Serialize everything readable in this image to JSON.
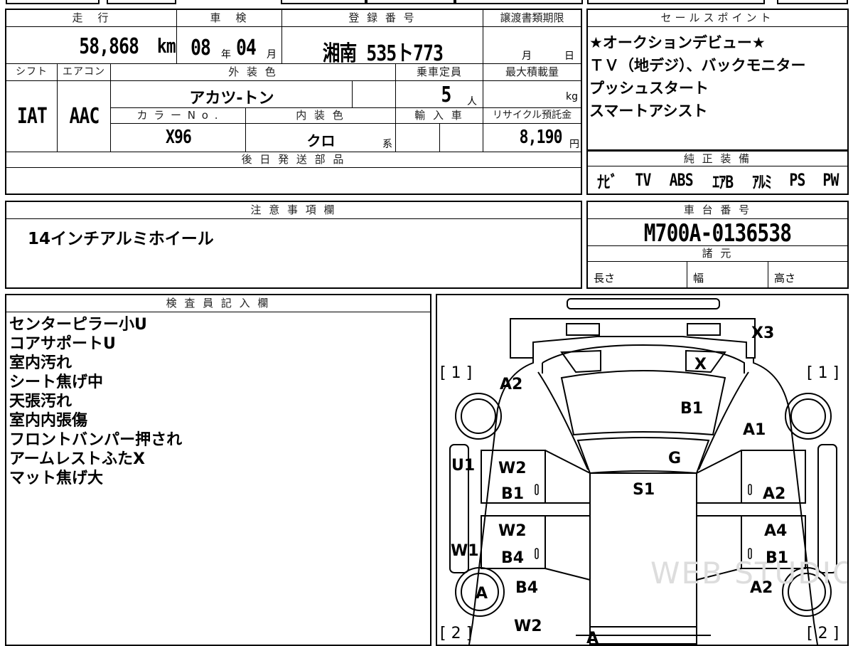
{
  "vehicle": {
    "mileage_label": "走　行",
    "mileage_value": "58,868",
    "mileage_unit": "km",
    "shaken_label": "車　検",
    "shaken_year": "08",
    "shaken_year_unit": "年",
    "shaken_month": "04",
    "shaken_month_unit": "月",
    "reg_label": "登 録 番 号",
    "reg_value": "湘南 535ト773",
    "transfer_label": "譲渡書類期限",
    "transfer_month_unit": "月",
    "transfer_day_unit": "日",
    "shift_label": "シフト",
    "shift_value": "IAT",
    "ac_label": "エアコン",
    "ac_value": "AAC",
    "exterior_label": "外 装 色",
    "exterior_value": "アカツ-トン",
    "capacity_label": "乗車定員",
    "capacity_value": "5",
    "capacity_unit": "人",
    "maxload_label": "最大積載量",
    "maxload_unit": "kg",
    "color_no_label": "カ ラ ー N o .",
    "color_no_value": "X96",
    "interior_label": "内 装 色",
    "interior_value": "クロ",
    "interior_unit": "系",
    "import_label": "輸 入 車",
    "recycle_label": "リサイクル預託金",
    "recycle_value": "8,190",
    "recycle_unit": "円",
    "later_parts_label": "後 日 発 送 部 品"
  },
  "sales": {
    "label": "セールスポイント",
    "lines": [
      "★オークションデビュー★",
      "ＴＶ（地デジ）、バックモニター",
      "プッシュスタート",
      "スマートアシスト"
    ]
  },
  "equipment": {
    "label": "純 正 装 備",
    "items": [
      "ﾅﾋﾞ",
      "TV",
      "ABS",
      "ｴｱB",
      "ｱﾙﾐ",
      "PS",
      "PW"
    ]
  },
  "notes": {
    "label": "注 意 事 項 欄",
    "text": "14インチアルミホイール"
  },
  "chassis": {
    "label": "車 台 番 号",
    "value": "M700A-0136538",
    "spec_label": "諸 元",
    "length": "長さ",
    "width": "幅",
    "height": "高さ"
  },
  "inspector": {
    "label": "検 査 員 記 入 欄",
    "lines": [
      "センターピラー小U",
      "コアサポートU",
      "室内汚れ",
      "シート焦げ中",
      "天張汚れ",
      "室内内張傷",
      "フロントバンパー押され",
      "アームレストふたX",
      "マット焦げ大"
    ]
  },
  "diagram": {
    "marks": {
      "x3": "X3",
      "x": "X",
      "a2_left": "A2",
      "b1_top": "B1",
      "a1": "A1",
      "g": "G",
      "u1": "U1",
      "w2_l1": "W2",
      "b1_l1": "B1",
      "s1": "S1",
      "a2_r1": "A2",
      "w2_l2": "W2",
      "w1": "W1",
      "b4_l2": "B4",
      "a4": "A4",
      "b1_r2": "B1",
      "a_wheel": "A",
      "b4_l3": "B4",
      "a2_r3": "A2",
      "w2_l4": "W2",
      "a_bottom": "A",
      "bracket_tl": "[ 1 ]",
      "bracket_tr": "[ 1 ]",
      "bracket_bl": "[ 2 ]",
      "bracket_br": "[ 2 ]",
      "zero": "0"
    },
    "watermark": "WEB STUDIO"
  }
}
